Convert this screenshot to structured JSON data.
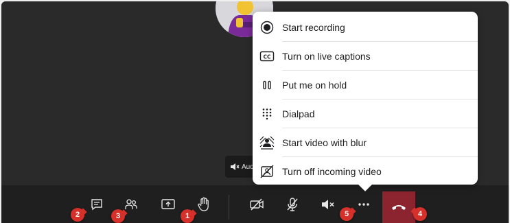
{
  "remote_participant": {
    "audio_label": "Aud"
  },
  "more_menu": {
    "items": [
      {
        "label": "Start recording",
        "icon": "record-icon"
      },
      {
        "label": "Turn on live captions",
        "icon": "captions-icon"
      },
      {
        "label": "Put me on hold",
        "icon": "hold-icon"
      },
      {
        "label": "Dialpad",
        "icon": "dialpad-icon"
      },
      {
        "label": "Start video with blur",
        "icon": "blur-video-icon"
      },
      {
        "label": "Turn off incoming video",
        "icon": "incoming-video-off-icon"
      }
    ]
  },
  "toolbar": {
    "buttons": [
      {
        "icon": "chat-icon"
      },
      {
        "icon": "people-icon"
      },
      {
        "icon": "share-screen-icon"
      },
      {
        "icon": "raise-hand-icon"
      },
      {
        "icon": "camera-off-icon"
      },
      {
        "icon": "mic-off-icon"
      },
      {
        "icon": "speaker-muted-icon"
      },
      {
        "icon": "more-options-icon"
      },
      {
        "icon": "hang-up-icon"
      }
    ],
    "hangup_color": "#8c2430"
  },
  "annotations": {
    "badges": [
      "2",
      "3",
      "1",
      "5",
      "4"
    ],
    "badge_color": "#d6302a"
  }
}
